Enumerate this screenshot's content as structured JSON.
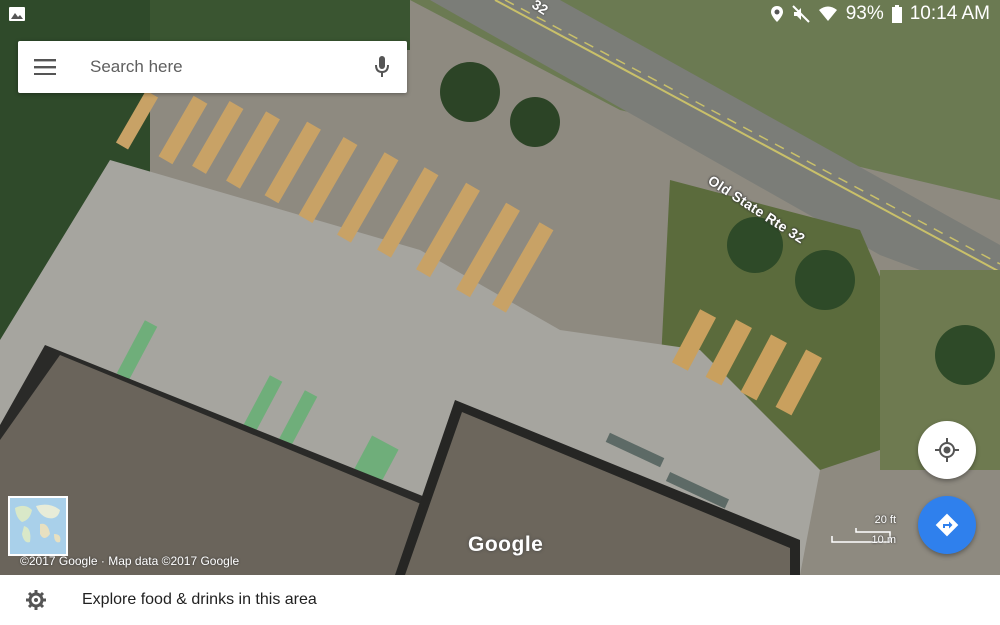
{
  "status_bar": {
    "battery": "93%",
    "time": "10:14 AM",
    "icons": [
      "image-icon",
      "location-icon",
      "mute-icon",
      "wifi-icon",
      "battery-icon"
    ]
  },
  "search": {
    "placeholder": "Search here",
    "menu_icon": "menu-icon",
    "mic_icon": "mic-icon"
  },
  "map": {
    "road_label": "Old State Rte 32",
    "road_label_top": "32",
    "logo": "Google",
    "copyright": "©2017 Google · Map data ©2017 Google",
    "scale_ft": "20 ft",
    "scale_m": "10 m",
    "locate_icon": "my-location-icon",
    "directions_icon": "directions-icon",
    "layers_thumbnail": "world-map-thumbnail"
  },
  "bottom": {
    "explore_text": "Explore food & drinks in this area",
    "explore_icon": "explore-icon"
  },
  "colors": {
    "accent": "#2f80ed",
    "statusbar_text": "#ffffff",
    "search_placeholder": "#5f5f5f"
  }
}
